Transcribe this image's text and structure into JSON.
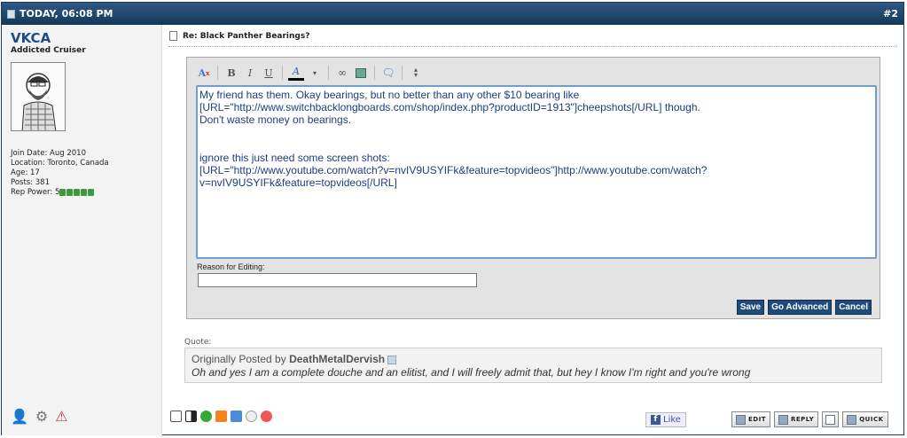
{
  "header": {
    "date": "TODAY, 06:08 PM",
    "post_number": "#2"
  },
  "user": {
    "name": "VKCA",
    "title": "Addicted Cruiser",
    "join_date": "Join Date: Aug 2010",
    "location": "Location: Toronto, Canada",
    "age": "Age: 17",
    "posts": "Posts: 381",
    "rep_power": "Rep Power: 5",
    "rep_blocks": 5
  },
  "post": {
    "title": "Re: Black Panther Bearings?"
  },
  "editor": {
    "text": "My friend has them. Okay bearings, but no better than any other $10 bearing like\n[URL=\"http://www.switchbacklongboards.com/shop/index.php?productID=1913\"]cheepshots[/URL] though.\nDon't waste money on bearings.\n\n\nignore this just need some screen shots:\n[URL=\"http://www.youtube.com/watch?v=nvIV9USYIFk&feature=topvideos\"]http://www.youtube.com/watch?\nv=nvIV9USYIFk&feature=topvideos[/URL]",
    "reason_label": "Reason for Editing:",
    "reason_value": "",
    "toolbar": [
      "B",
      "I",
      "U",
      "A"
    ],
    "save": "Save",
    "go_advanced": "Go Advanced",
    "cancel": "Cancel"
  },
  "quote": {
    "label": "Quote:",
    "prefix": "Originally Posted by ",
    "author": "DeathMetalDervish",
    "text": "Oh and yes I am a complete douche and an elitist, and I will freely admit that, but hey I know I'm right and you're wrong"
  },
  "like": {
    "label": "Like"
  },
  "actions": {
    "edit": "EDIT",
    "reply": "REPLY",
    "quick": "QUICK"
  },
  "colors": {
    "header_bg": "#1f4266",
    "username": "#1b4d8a",
    "button_bg": "#1f4b7a",
    "editor_text": "#1d3e7e"
  }
}
